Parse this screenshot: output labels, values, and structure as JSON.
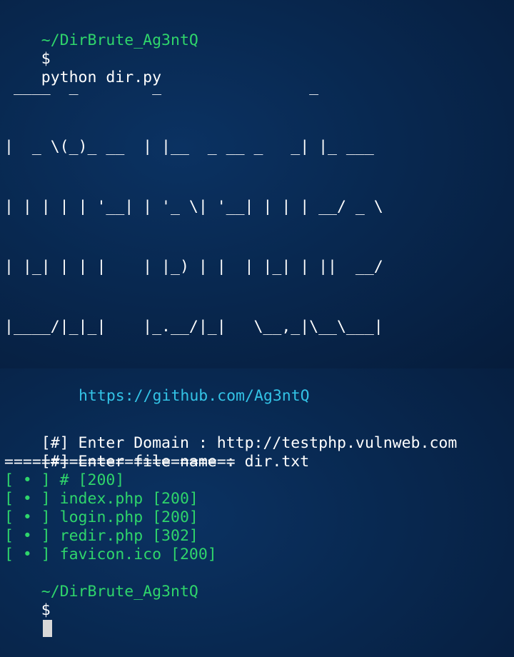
{
  "prompt": {
    "path": "~/DirBrute_Ag3ntQ",
    "symbol": "$",
    "command": "python dir.py"
  },
  "banner": {
    "ascii_lines": [
      " ____  _        _                _        ",
      "|  _ \\(_)_ __  | |__  _ __ _   _| |_ ___ ",
      "| | | | | '__| | '_ \\| '__| | | | __/ _ \\",
      "| |_| | | |    | |_) | |  | |_| | ||  __/",
      "|____/|_|_|    |_.__/|_|   \\__,_|\\__\\___|"
    ],
    "link": "https://github.com/Ag3ntQ"
  },
  "inputs": {
    "domain_label": "[#] Enter Domain : ",
    "domain_value": "http://testphp.vulnweb.com",
    "file_label": "[#] Enter file name : ",
    "file_value": "dir.txt"
  },
  "separator": "=========================",
  "results": [
    "[ • ] # [200]",
    "[ • ] index.php [200]",
    "[ • ] login.php [200]",
    "[ • ] redir.php [302]",
    "[ • ] favicon.ico [200]"
  ],
  "final_prompt": {
    "path": "~/DirBrute_Ag3ntQ",
    "symbol": "$"
  },
  "colors": {
    "prompt_green": "#2fd56b",
    "link_cyan": "#33c3e6",
    "text_white": "#ffffff",
    "background": "#082850"
  }
}
